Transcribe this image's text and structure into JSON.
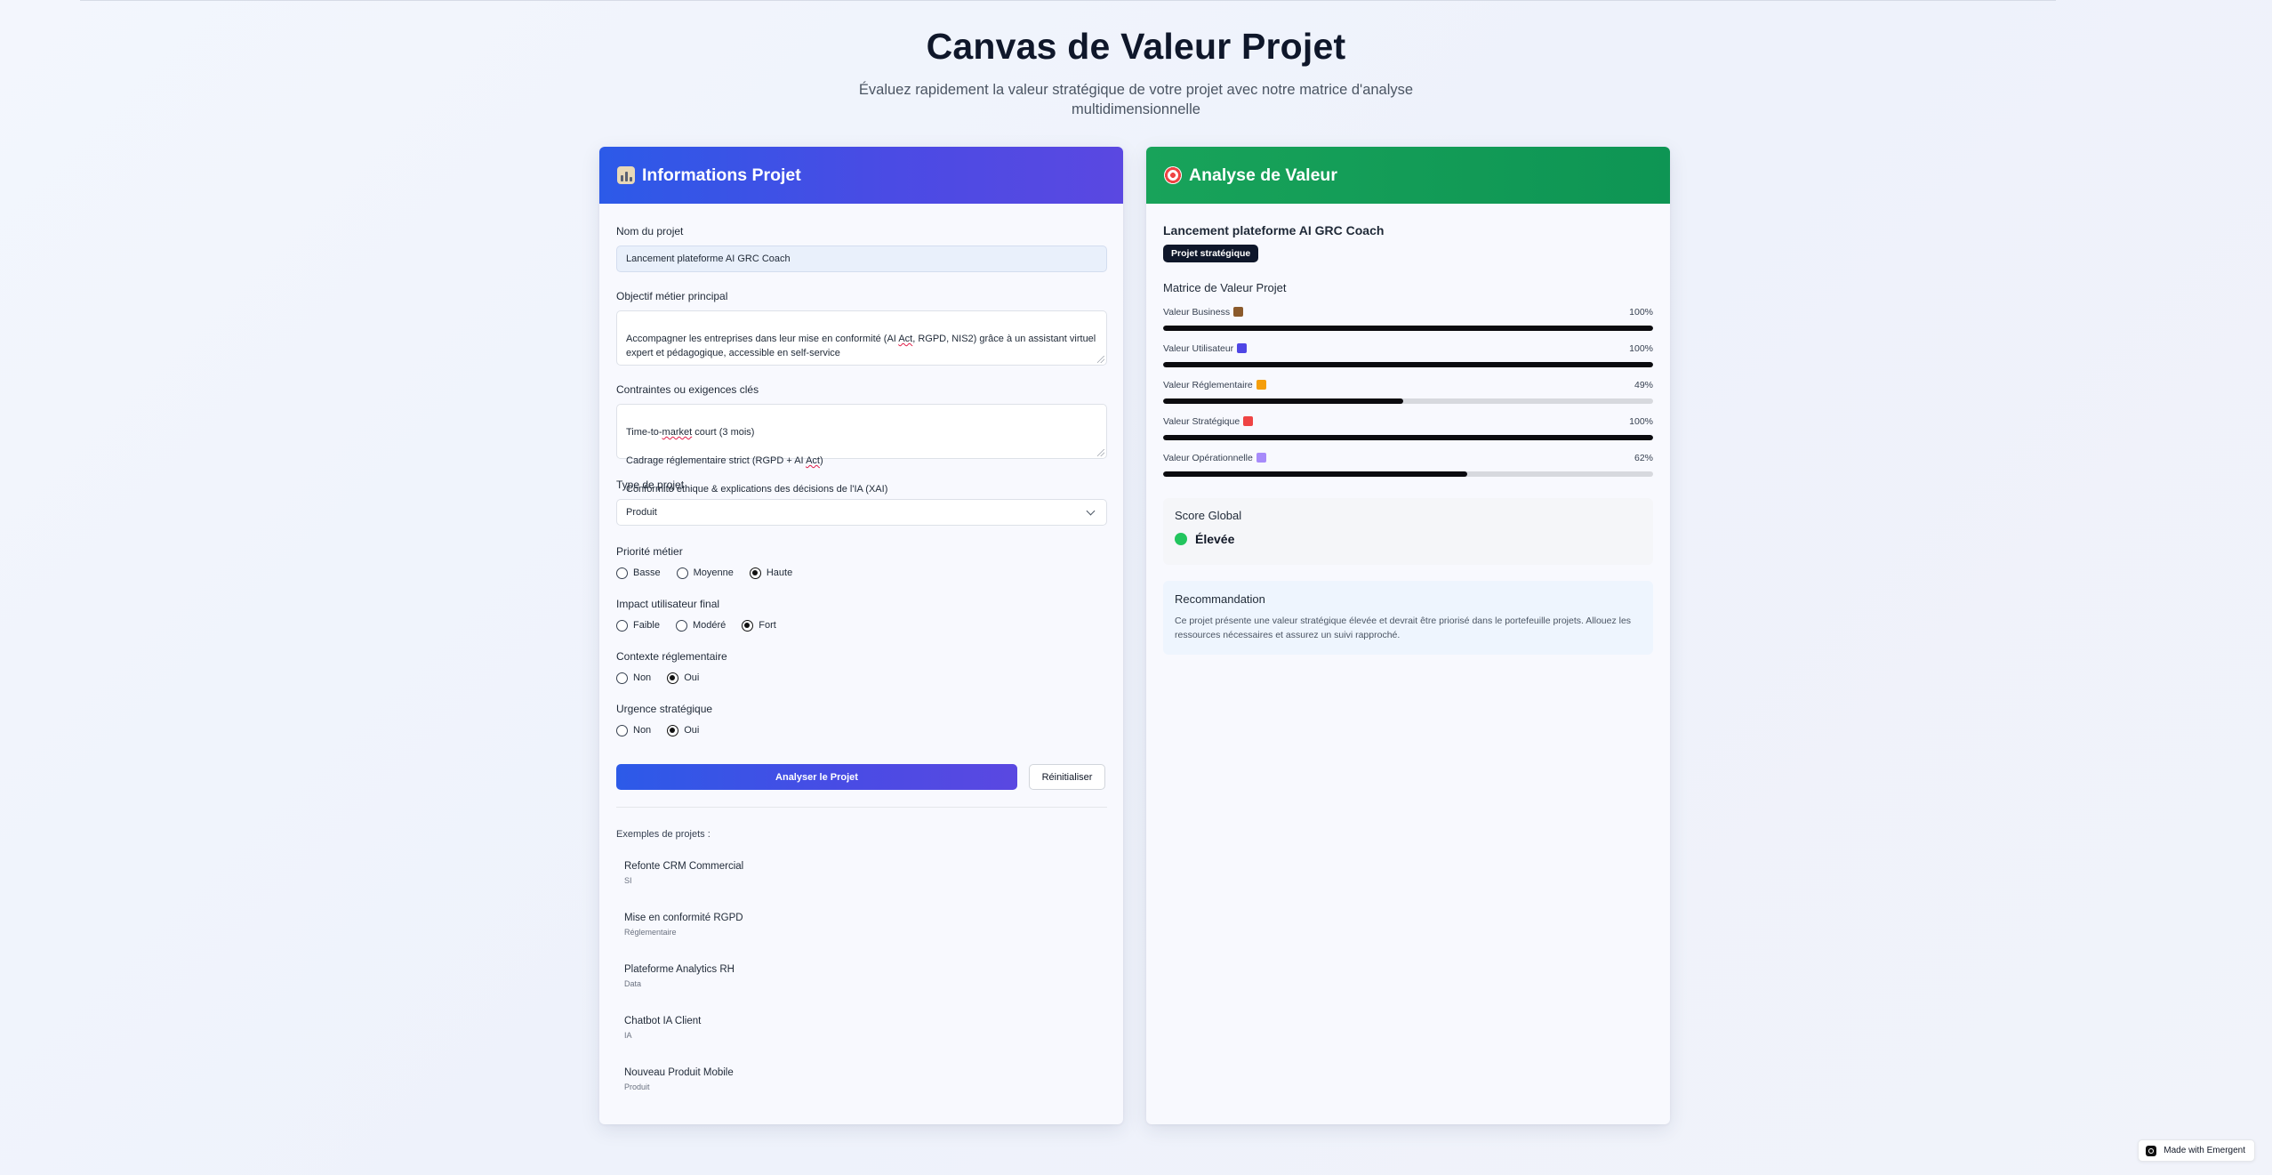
{
  "page": {
    "title": "Canvas de Valeur Projet",
    "subtitle": "Évaluez rapidement la valeur stratégique de votre projet avec notre matrice d'analyse multidimensionnelle"
  },
  "form_card": {
    "title": "Informations Projet",
    "icon": "bar-chart-icon",
    "name_label": "Nom du projet",
    "name_value": "Lancement plateforme AI GRC Coach",
    "objective_label": "Objectif métier principal",
    "objective_value": "Accompagner les entreprises dans leur mise en conformité (AI Act, RGPD, NIS2) grâce à un assistant virtuel expert et pédagogique, accessible en self-service",
    "constraints_label": "Contraintes ou exigences clés",
    "constraints_lines": [
      "Time-to-market court (3 mois)",
      "Cadrage réglementaire strict (RGPD + AI Act)",
      "Conformité éthique & explications des décisions de l'IA (XAI)"
    ],
    "type_label": "Type de projet",
    "type_value": "Produit",
    "priority": {
      "label": "Priorité métier",
      "options": [
        "Basse",
        "Moyenne",
        "Haute"
      ],
      "selected": "Haute"
    },
    "impact": {
      "label": "Impact utilisateur final",
      "options": [
        "Faible",
        "Modéré",
        "Fort"
      ],
      "selected": "Fort"
    },
    "regulatory": {
      "label": "Contexte réglementaire",
      "options": [
        "Non",
        "Oui"
      ],
      "selected": "Oui"
    },
    "urgency": {
      "label": "Urgence stratégique",
      "options": [
        "Non",
        "Oui"
      ],
      "selected": "Oui"
    },
    "analyze_button": "Analyser le Projet",
    "reset_button": "Réinitialiser",
    "examples_label": "Exemples de projets :",
    "examples": [
      {
        "name": "Refonte CRM Commercial",
        "type": "SI"
      },
      {
        "name": "Mise en conformité RGPD",
        "type": "Réglementaire"
      },
      {
        "name": "Plateforme Analytics RH",
        "type": "Data"
      },
      {
        "name": "Chatbot IA Client",
        "type": "IA"
      },
      {
        "name": "Nouveau Produit Mobile",
        "type": "Produit"
      }
    ]
  },
  "analysis_card": {
    "title": "Analyse de Valeur",
    "icon": "target-icon",
    "project_name": "Lancement plateforme AI GRC Coach",
    "badge": "Projet stratégique",
    "matrix_title": "Matrice de Valeur Projet",
    "metrics": [
      {
        "label": "Valeur Business",
        "icon": "briefcase-icon",
        "icon_color": "#8b5a2b",
        "value": 100,
        "display": "100%"
      },
      {
        "label": "Valeur Utilisateur",
        "icon": "user-icon",
        "icon_color": "#4f46e5",
        "value": 100,
        "display": "100%"
      },
      {
        "label": "Valeur Réglementaire",
        "icon": "scales-icon",
        "icon_color": "#f59e0b",
        "value": 49,
        "display": "49%"
      },
      {
        "label": "Valeur Stratégique",
        "icon": "target-icon",
        "icon_color": "#ef4444",
        "value": 100,
        "display": "100%"
      },
      {
        "label": "Valeur Opérationnelle",
        "icon": "gear-icon",
        "icon_color": "#a78bfa",
        "value": 62,
        "display": "62%"
      }
    ],
    "score_title": "Score Global",
    "score_value": "Élevée",
    "score_color": "#22c55e",
    "recommendation_title": "Recommandation",
    "recommendation_text": "Ce projet présente une valeur stratégique élevée et devrait être priorisé dans le portefeuille projets. Allouez les ressources nécessaires et assurez un suivi rapproché."
  },
  "badge_made_with": "Made with Emergent"
}
